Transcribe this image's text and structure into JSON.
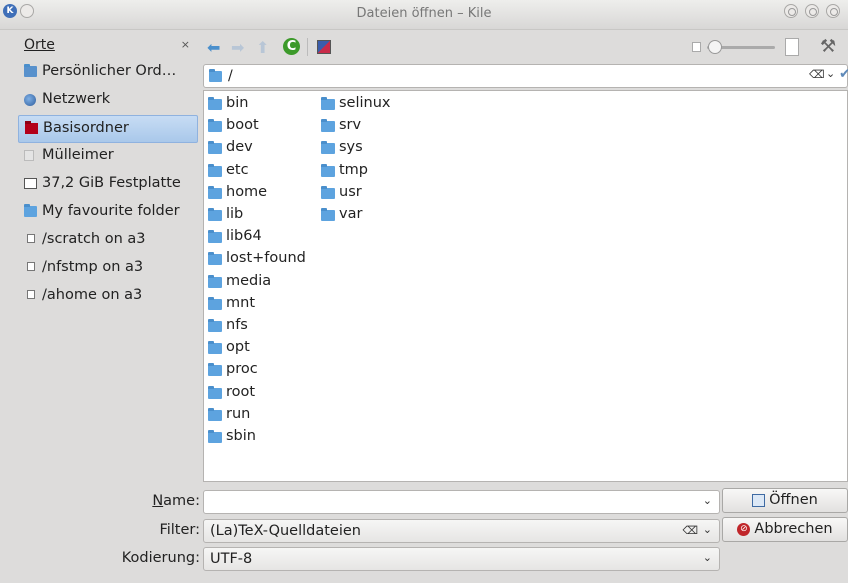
{
  "window": {
    "title": "Dateien öffnen – Kile"
  },
  "places": {
    "header": "Orte",
    "close": "×",
    "items": [
      {
        "label": "Persönlicher Ord…",
        "icon": "home-folder-icon"
      },
      {
        "label": "Netzwerk",
        "icon": "network-icon"
      },
      {
        "label": "Basisordner",
        "icon": "root-folder-icon",
        "selected": true
      },
      {
        "label": "Mülleimer",
        "icon": "trash-icon"
      },
      {
        "label": "37,2 GiB Festplatte",
        "icon": "harddisk-icon"
      },
      {
        "label": "My favourite folder",
        "icon": "folder-icon"
      },
      {
        "label": "/scratch on a3",
        "icon": "mount-icon"
      },
      {
        "label": "/nfstmp on a3",
        "icon": "mount-icon"
      },
      {
        "label": "/ahome on a3",
        "icon": "mount-icon"
      }
    ]
  },
  "toolbar": {
    "back": "⬅",
    "forward": "➡",
    "up": "⬆",
    "reload": "C",
    "tools": "⚒"
  },
  "location": {
    "path": "/",
    "clear": "⌫",
    "dropdown": "⌄",
    "confirm": "✔"
  },
  "files": {
    "column1": [
      "bin",
      "boot",
      "dev",
      "etc",
      "home",
      "lib",
      "lib64",
      "lost+found",
      "media",
      "mnt",
      "nfs",
      "opt",
      "proc",
      "root",
      "run",
      "sbin"
    ],
    "column2": [
      "selinux",
      "srv",
      "sys",
      "tmp",
      "usr",
      "var"
    ]
  },
  "form": {
    "name_label": "Name:",
    "name_value": "",
    "filter_label": "Filter:",
    "filter_value": "(La)TeX-Quelldateien",
    "encoding_label": "Kodierung:",
    "encoding_value": "UTF-8",
    "dropdown": "⌄",
    "clear": "⌫"
  },
  "buttons": {
    "open": "Öffnen",
    "cancel": "Abbrechen",
    "cancel_glyph": "⊘"
  },
  "colors": {
    "folder": "#5da3df",
    "selection": "#a9c8ea",
    "root_folder": "#b3001b",
    "reload": "#3c9a2a"
  }
}
